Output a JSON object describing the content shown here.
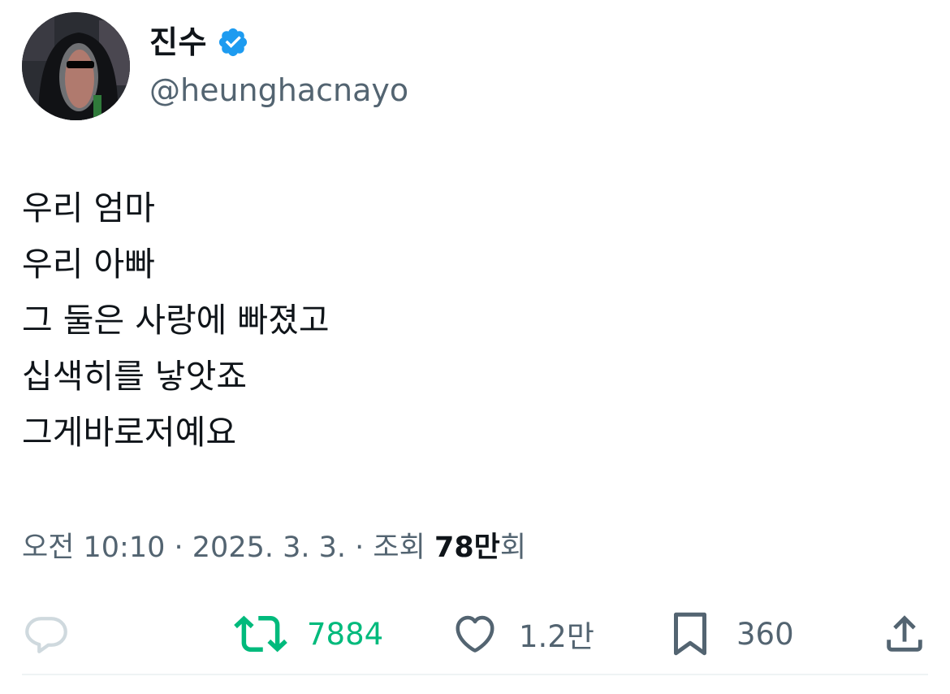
{
  "author": {
    "name": "진수",
    "handle": "@heunghacnayo",
    "verified": true
  },
  "tweet": {
    "lines": [
      "우리 엄마",
      "우리 아빠",
      "그 둘은 사랑에 빠졌고",
      "십색히를 낳앗죠",
      "그게바로저예요"
    ]
  },
  "meta": {
    "time": "오전 10:10",
    "separator": " · ",
    "date": "2025. 3. 3.",
    "views_label": "조회",
    "views_number": "78만",
    "views_suffix": "회"
  },
  "actions": {
    "retweets": "7884",
    "likes": "1.2만",
    "bookmarks": "360"
  },
  "colors": {
    "text": "#0f1419",
    "secondary": "#536471",
    "verified": "#1d9bf0",
    "retweet_active": "#00ba7c",
    "reply_icon": "#cfd9de"
  }
}
